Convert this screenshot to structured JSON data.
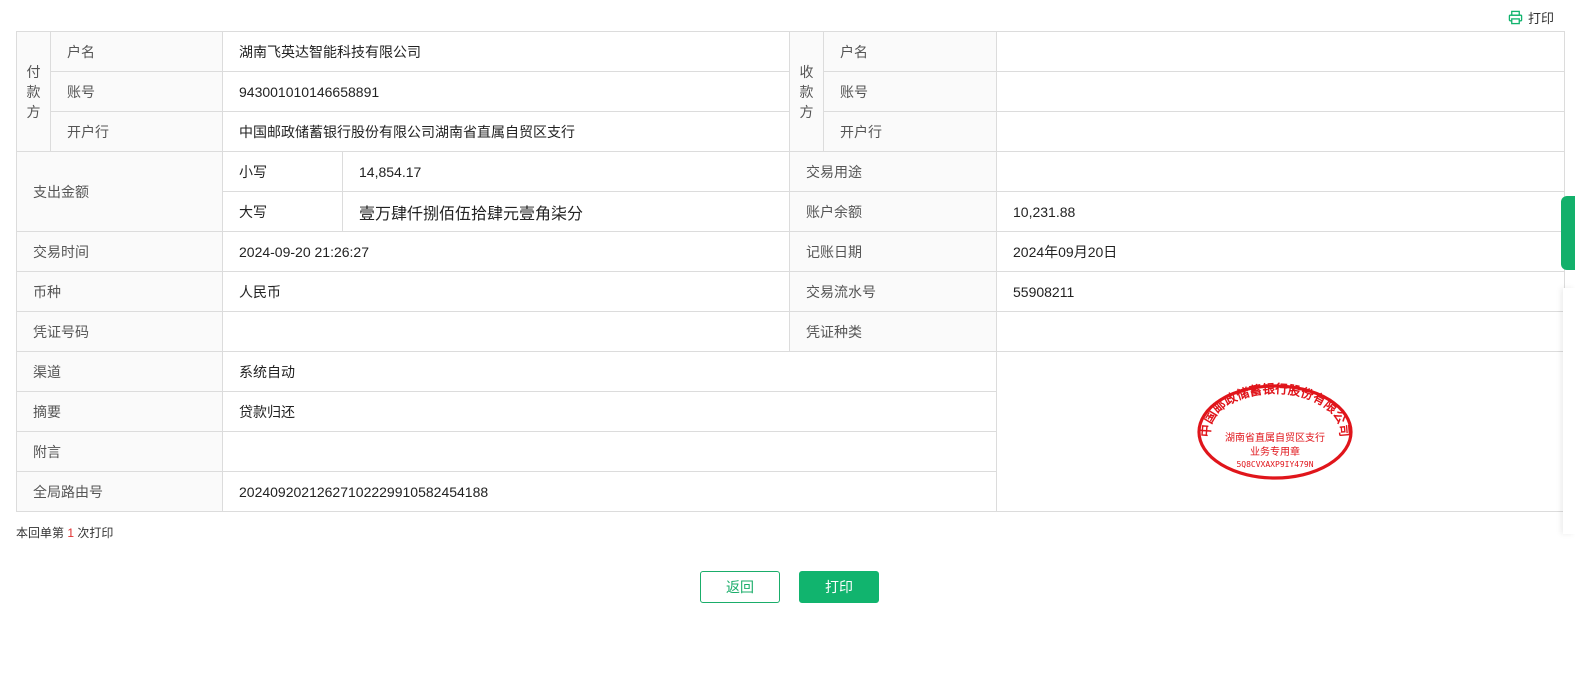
{
  "toolbar": {
    "print_label": "打印",
    "icon": "printer-icon"
  },
  "payer": {
    "side_label": "付款方",
    "name_label": "户名",
    "name": "湖南飞英达智能科技有限公司",
    "account_label": "账号",
    "account": "943001010146658891",
    "bank_label": "开户行",
    "bank": "中国邮政储蓄银行股份有限公司湖南省直属自贸区支行"
  },
  "payee": {
    "side_label": "收款方",
    "name_label": "户名",
    "name": "",
    "account_label": "账号",
    "account": "",
    "bank_label": "开户行",
    "bank": ""
  },
  "amount": {
    "label": "支出金额",
    "lower_label": "小写",
    "lower": "14,854.17",
    "upper_label": "大写",
    "upper": "壹万肆仟捌佰伍拾肆元壹角柒分"
  },
  "fields": {
    "purpose_label": "交易用途",
    "purpose": "",
    "balance_label": "账户余额",
    "balance": "10,231.88",
    "time_label": "交易时间",
    "time": "2024-09-20 21:26:27",
    "book_date_label": "记账日期",
    "book_date": "2024年09月20日",
    "currency_label": "币种",
    "currency": "人民币",
    "serial_label": "交易流水号",
    "serial": "55908211",
    "voucher_no_label": "凭证号码",
    "voucher_no": "",
    "voucher_type_label": "凭证种类",
    "voucher_type": "",
    "channel_label": "渠道",
    "channel": "系统自动",
    "summary_label": "摘要",
    "summary": "贷款归还",
    "remark_label": "附言",
    "remark": "",
    "route_label": "全局路由号",
    "route": "20240920212627102229910582454188"
  },
  "stamp": {
    "ring_text": "中国邮政储蓄银行股份有限公司",
    "line1": "湖南省直属自贸区支行",
    "line2": "业务专用章",
    "code": "5Q8CVXAXP9IY479N",
    "color": "#e0151b"
  },
  "footer": {
    "pre": "本回单第",
    "count": "1",
    "post": "次打印"
  },
  "buttons": {
    "back": "返回",
    "print": "打印"
  },
  "colors": {
    "accent": "#11b46e",
    "border": "#dcdcdc",
    "label_bg": "#fafafa"
  }
}
